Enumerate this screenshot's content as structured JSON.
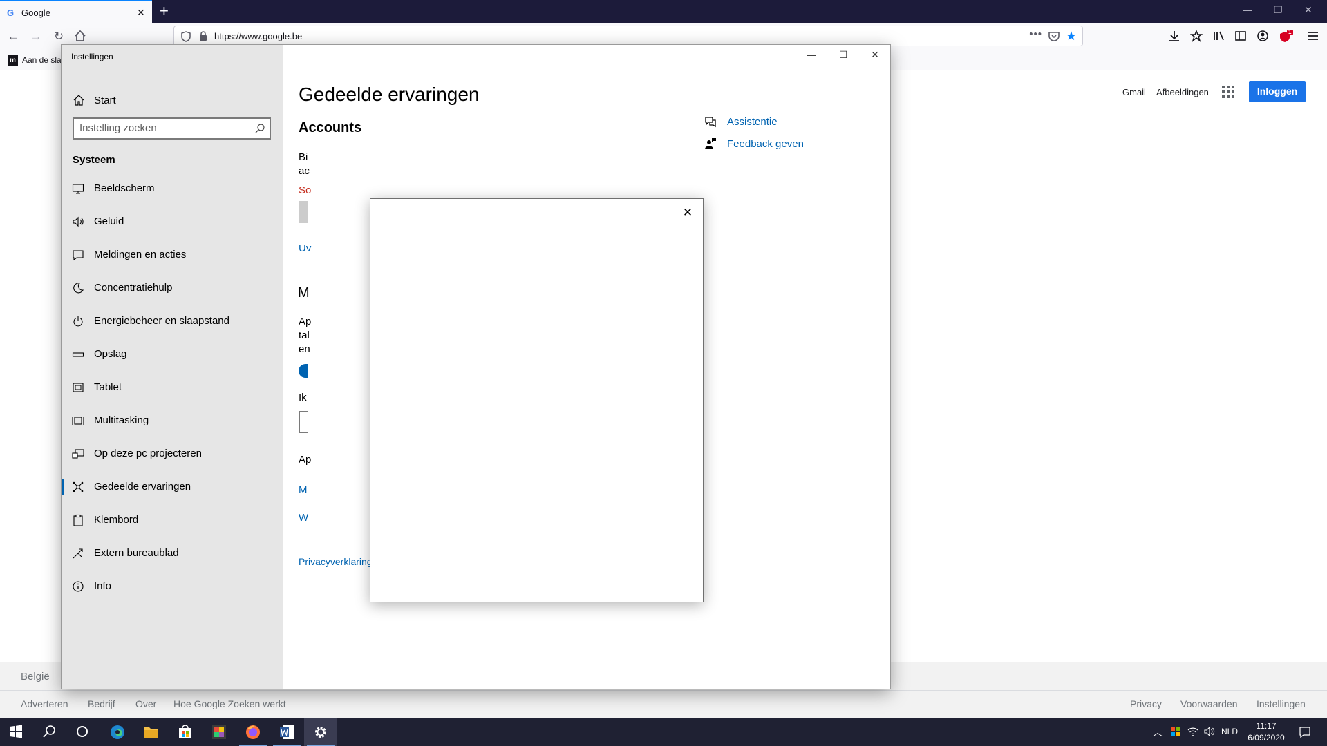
{
  "browser": {
    "tab_title": "Google",
    "tab_favicon": "G",
    "url": "https://www.google.be",
    "bookmark_label": "Aan de sla",
    "bookmark_icon": "m",
    "badge_count": "1"
  },
  "google": {
    "header": {
      "gmail": "Gmail",
      "images": "Afbeeldingen",
      "signin": "Inloggen"
    },
    "footer": {
      "country": "België",
      "left_links": [
        "Adverteren",
        "Bedrijf",
        "Over",
        "Hoe Google Zoeken werkt"
      ],
      "right_links": [
        "Privacy",
        "Voorwaarden",
        "Instellingen"
      ]
    }
  },
  "settings": {
    "window_title": "Instellingen",
    "home_label": "Start",
    "search_placeholder": "Instelling zoeken",
    "section_heading": "Systeem",
    "nav_items": [
      {
        "label": "Beeldscherm",
        "icon": "monitor-icon"
      },
      {
        "label": "Geluid",
        "icon": "speaker-icon"
      },
      {
        "label": "Meldingen en acties",
        "icon": "notification-icon"
      },
      {
        "label": "Concentratiehulp",
        "icon": "moon-icon"
      },
      {
        "label": "Energiebeheer en slaapstand",
        "icon": "power-icon"
      },
      {
        "label": "Opslag",
        "icon": "storage-icon"
      },
      {
        "label": "Tablet",
        "icon": "tablet-icon"
      },
      {
        "label": "Multitasking",
        "icon": "multitasking-icon"
      },
      {
        "label": "Op deze pc projecteren",
        "icon": "project-icon"
      },
      {
        "label": "Gedeelde ervaringen",
        "icon": "shared-experiences-icon",
        "active": true
      },
      {
        "label": "Klembord",
        "icon": "clipboard-icon"
      },
      {
        "label": "Extern bureaublad",
        "icon": "remote-desktop-icon"
      },
      {
        "label": "Info",
        "icon": "info-icon"
      }
    ],
    "page_title": "Gedeelde ervaringen",
    "accounts_heading": "Accounts",
    "partial_texts": {
      "bij": "Bi",
      "ac": "ac",
      "so": "So",
      "uv": "Uv",
      "m_head": "M",
      "ap1": "Ap",
      "tal": "tal",
      "en": "en",
      "ik": "Ik",
      "ap2": "Ap",
      "m_link": "M",
      "w_link": "W"
    },
    "privacy_link": "Privacyverklaring",
    "help_links": [
      {
        "label": "Assistentie",
        "icon": "help-chat-icon"
      },
      {
        "label": "Feedback geven",
        "icon": "feedback-icon"
      }
    ],
    "accent_color": "#0063b1"
  },
  "taskbar": {
    "apps": [
      "start-icon",
      "search-icon",
      "cortana-icon",
      "edge-icon",
      "file-explorer-icon",
      "store-icon",
      "photos-icon",
      "firefox-icon",
      "word-icon",
      "settings-icon"
    ],
    "language": "NLD",
    "time": "11:17",
    "date": "6/09/2020"
  }
}
